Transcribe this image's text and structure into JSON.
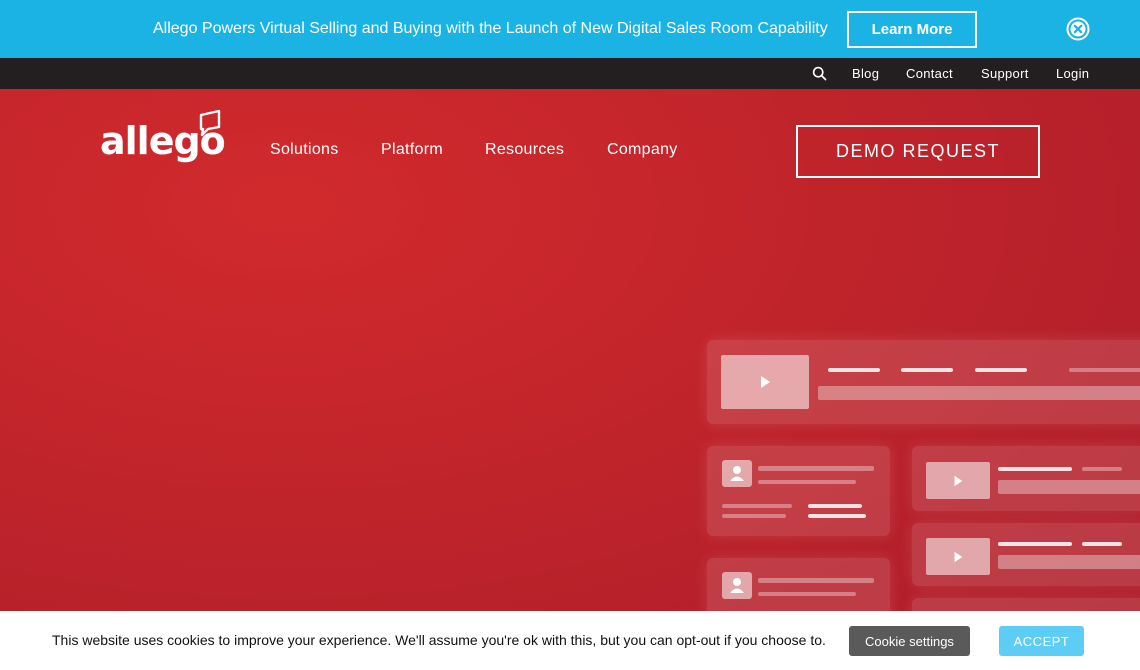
{
  "announcement": {
    "text": "Allego Powers Virtual Selling and Buying with the Launch of New Digital Sales Room Capability",
    "button_label": "Learn More"
  },
  "utility_nav": {
    "items": [
      "Blog",
      "Contact",
      "Support",
      "Login"
    ]
  },
  "header": {
    "logo_text": "allego",
    "nav": [
      "Solutions",
      "Platform",
      "Resources",
      "Company"
    ],
    "cta_label": "DEMO REQUEST"
  },
  "cookie_banner": {
    "text": "This website uses cookies to improve your experience. We'll assume you're ok with this, but you can opt-out if you choose to.",
    "settings_label": "Cookie settings",
    "accept_label": "ACCEPT"
  },
  "colors": {
    "announcement_bg": "#1ab3e3",
    "utility_bg": "#231f20",
    "hero_bg": "#c0242b",
    "accept_bg": "#5ecdf5"
  }
}
